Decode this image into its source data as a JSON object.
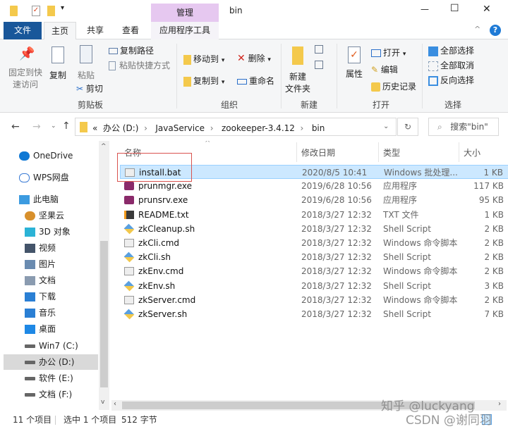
{
  "window": {
    "title": "bin",
    "context_tab": "管理",
    "controls": {
      "minimize": "—",
      "maximize": "☐",
      "close": "✕"
    }
  },
  "tabs": [
    {
      "label": "文件"
    },
    {
      "label": "主页"
    },
    {
      "label": "共享"
    },
    {
      "label": "查看"
    },
    {
      "label": "应用程序工具"
    }
  ],
  "ribbon": {
    "clipboard": {
      "label": "剪贴板",
      "pin": "固定到快速访问",
      "pin1": "固定到快",
      "pin2": "速访问",
      "copy": "复制",
      "paste": "粘贴",
      "copy_path": "复制路径",
      "paste_shortcut": "粘贴快捷方式",
      "cut": "剪切"
    },
    "organize": {
      "label": "组织",
      "move_to": "移动到",
      "copy_to": "复制到",
      "delete": "删除",
      "rename": "重命名"
    },
    "new": {
      "label": "新建",
      "new_folder1": "新建",
      "new_folder2": "文件夹"
    },
    "open": {
      "label": "打开",
      "properties": "属性",
      "open": "打开",
      "edit": "编辑",
      "history": "历史记录"
    },
    "select": {
      "label": "选择",
      "select_all": "全部选择",
      "select_none": "全部取消",
      "invert": "反向选择"
    }
  },
  "address": {
    "path": [
      "«",
      "办公 (D:)",
      "JavaService",
      "zookeeper-3.4.12",
      "bin"
    ],
    "search_placeholder": "搜索\"bin\""
  },
  "nav": [
    {
      "label": "OneDrive",
      "icon": "cloud-icon",
      "color": "#0f78d4"
    },
    {
      "label": "WPS网盘",
      "icon": "cloud-outline-icon",
      "color": "#3a7bd5"
    },
    {
      "label": "此电脑",
      "icon": "computer-icon",
      "color": "#3c9be0"
    },
    {
      "label": "坚果云",
      "icon": "nut-icon",
      "color": "#d8902c"
    },
    {
      "label": "3D 对象",
      "icon": "cube-icon",
      "color": "#2bb3d6"
    },
    {
      "label": "视频",
      "icon": "film-icon",
      "color": "#44546a"
    },
    {
      "label": "图片",
      "icon": "picture-icon",
      "color": "#6a8bb0"
    },
    {
      "label": "文档",
      "icon": "document-icon",
      "color": "#8a9bb0"
    },
    {
      "label": "下载",
      "icon": "download-icon",
      "color": "#2a7fd4"
    },
    {
      "label": "音乐",
      "icon": "music-icon",
      "color": "#2a7fd4"
    },
    {
      "label": "桌面",
      "icon": "desktop-icon",
      "color": "#1e88e5"
    },
    {
      "label": "Win7 (C:)",
      "icon": "system-drive-icon",
      "color": "#666"
    },
    {
      "label": "办公 (D:)",
      "icon": "drive-icon",
      "color": "#666",
      "selected": true
    },
    {
      "label": "软件 (E:)",
      "icon": "drive-icon",
      "color": "#666"
    },
    {
      "label": "文档 (F:)",
      "icon": "drive-icon",
      "color": "#666"
    }
  ],
  "columns": {
    "name": "名称",
    "date": "修改日期",
    "type": "类型",
    "size": "大小"
  },
  "files": [
    {
      "name": "install.bat",
      "date": "2020/8/5 10:41",
      "type": "Windows 批处理...",
      "size": "1 KB",
      "icon": "batch-file-icon",
      "selected": true
    },
    {
      "name": "prunmgr.exe",
      "date": "2019/6/28 10:56",
      "type": "应用程序",
      "size": "117 KB",
      "icon": "exe-icon"
    },
    {
      "name": "prunsrv.exe",
      "date": "2019/6/28 10:56",
      "type": "应用程序",
      "size": "95 KB",
      "icon": "exe-icon"
    },
    {
      "name": "README.txt",
      "date": "2018/3/27 12:32",
      "type": "TXT 文件",
      "size": "1 KB",
      "icon": "sublime-text-icon"
    },
    {
      "name": "zkCleanup.sh",
      "date": "2018/3/27 12:32",
      "type": "Shell Script",
      "size": "2 KB",
      "icon": "shell-script-icon"
    },
    {
      "name": "zkCli.cmd",
      "date": "2018/3/27 12:32",
      "type": "Windows 命令脚本",
      "size": "2 KB",
      "icon": "cmd-file-icon"
    },
    {
      "name": "zkCli.sh",
      "date": "2018/3/27 12:32",
      "type": "Shell Script",
      "size": "2 KB",
      "icon": "shell-script-icon"
    },
    {
      "name": "zkEnv.cmd",
      "date": "2018/3/27 12:32",
      "type": "Windows 命令脚本",
      "size": "2 KB",
      "icon": "cmd-file-icon"
    },
    {
      "name": "zkEnv.sh",
      "date": "2018/3/27 12:32",
      "type": "Shell Script",
      "size": "3 KB",
      "icon": "shell-script-icon"
    },
    {
      "name": "zkServer.cmd",
      "date": "2018/3/27 12:32",
      "type": "Windows 命令脚本",
      "size": "2 KB",
      "icon": "cmd-file-icon"
    },
    {
      "name": "zkServer.sh",
      "date": "2018/3/27 12:32",
      "type": "Shell Script",
      "size": "7 KB",
      "icon": "shell-script-icon"
    }
  ],
  "status": {
    "count": "11 个项目",
    "selected": "选中 1 个项目",
    "size": "512 字节"
  },
  "watermark": {
    "line1": "知乎 @luckyang",
    "line2": "CSDN @谢同羽"
  },
  "colors": {
    "file_tab": "#19579a",
    "manage_tab": "#e6c8f0",
    "selection": "#cce8ff",
    "highlight_box": "#d9534f"
  }
}
